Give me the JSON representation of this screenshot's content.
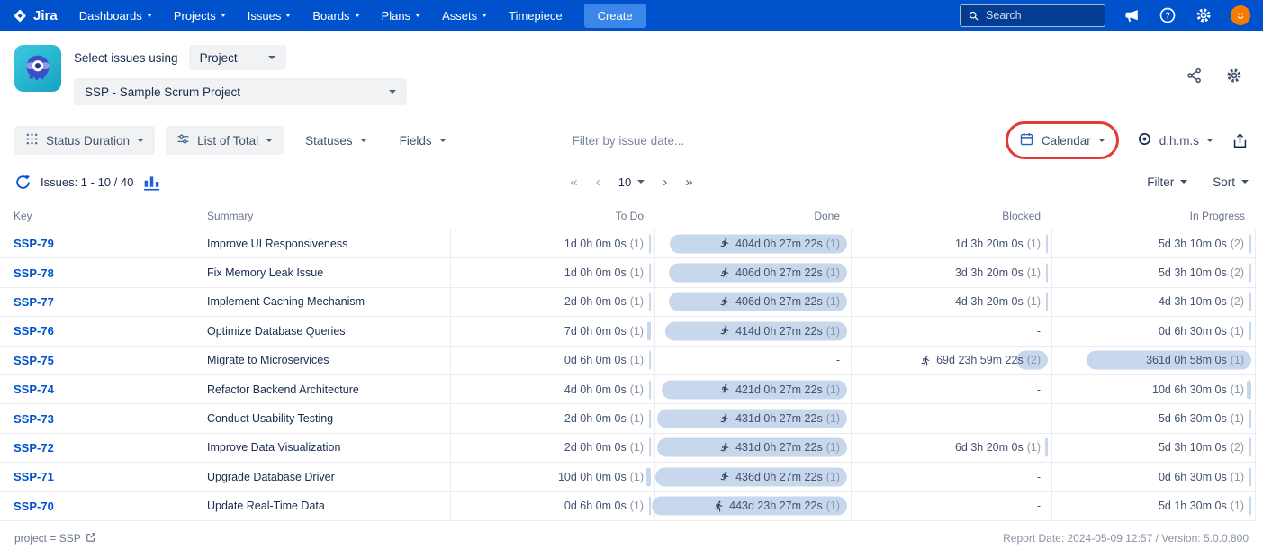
{
  "navbar": {
    "brand": "Jira",
    "items": [
      {
        "label": "Dashboards",
        "dropdown": true
      },
      {
        "label": "Projects",
        "dropdown": true
      },
      {
        "label": "Issues",
        "dropdown": true
      },
      {
        "label": "Boards",
        "dropdown": true
      },
      {
        "label": "Plans",
        "dropdown": true
      },
      {
        "label": "Assets",
        "dropdown": true
      },
      {
        "label": "Timepiece",
        "dropdown": false
      }
    ],
    "create_label": "Create",
    "search_placeholder": "Search"
  },
  "header": {
    "select_issues_label": "Select issues using",
    "issue_source": "Project",
    "project": "SSP - Sample Scrum Project"
  },
  "toolbar": {
    "report_type": "Status Duration",
    "list_mode": "List of Total",
    "statuses_label": "Statuses",
    "fields_label": "Fields",
    "date_filter_placeholder": "Filter by issue date...",
    "calendar_label": "Calendar",
    "time_format": "d.h.m.s"
  },
  "resultsbar": {
    "issues_label": "Issues: 1 - 10 / 40",
    "pagination": {
      "first": "«",
      "prev": "‹",
      "page_size": "10",
      "next": "›",
      "last": "»"
    },
    "filter_label": "Filter",
    "sort_label": "Sort"
  },
  "table": {
    "columns": [
      "Key",
      "Summary",
      "To Do",
      "Done",
      "Blocked",
      "In Progress"
    ],
    "max_days": 444,
    "rows": [
      {
        "key": "SSP-79",
        "summary": "Improve UI Responsiveness",
        "todo": {
          "text": "1d 0h 0m 0s",
          "count": "(1)",
          "days": 1
        },
        "done": {
          "text": "404d 0h 27m 22s",
          "count": "(1)",
          "days": 404,
          "runner": true
        },
        "blocked": {
          "text": "1d 3h 20m 0s",
          "count": "(1)",
          "days": 1.14
        },
        "inprogress": {
          "text": "5d 3h 10m 0s",
          "count": "(2)",
          "days": 5.13
        }
      },
      {
        "key": "SSP-78",
        "summary": "Fix Memory Leak Issue",
        "todo": {
          "text": "1d 0h 0m 0s",
          "count": "(1)",
          "days": 1
        },
        "done": {
          "text": "406d 0h 27m 22s",
          "count": "(1)",
          "days": 406,
          "runner": true
        },
        "blocked": {
          "text": "3d 3h 20m 0s",
          "count": "(1)",
          "days": 3.14
        },
        "inprogress": {
          "text": "5d 3h 10m 0s",
          "count": "(2)",
          "days": 5.13
        }
      },
      {
        "key": "SSP-77",
        "summary": "Implement Caching Mechanism",
        "todo": {
          "text": "2d 0h 0m 0s",
          "count": "(1)",
          "days": 2
        },
        "done": {
          "text": "406d 0h 27m 22s",
          "count": "(1)",
          "days": 406,
          "runner": true
        },
        "blocked": {
          "text": "4d 3h 20m 0s",
          "count": "(1)",
          "days": 4.14
        },
        "inprogress": {
          "text": "4d 3h 10m 0s",
          "count": "(2)",
          "days": 4.13
        }
      },
      {
        "key": "SSP-76",
        "summary": "Optimize Database Queries",
        "todo": {
          "text": "7d 0h 0m 0s",
          "count": "(1)",
          "days": 7
        },
        "done": {
          "text": "414d 0h 27m 22s",
          "count": "(1)",
          "days": 414,
          "runner": true
        },
        "blocked": null,
        "inprogress": {
          "text": "0d 6h 30m 0s",
          "count": "(1)",
          "days": 0.27
        }
      },
      {
        "key": "SSP-75",
        "summary": "Migrate to Microservices",
        "todo": {
          "text": "0d 6h 0m 0s",
          "count": "(1)",
          "days": 0.25
        },
        "done": null,
        "blocked": {
          "text": "69d 23h 59m 22s",
          "count": "(2)",
          "days": 70,
          "runner": true
        },
        "inprogress": {
          "text": "361d 0h 58m 0s",
          "count": "(1)",
          "days": 361
        }
      },
      {
        "key": "SSP-74",
        "summary": "Refactor Backend Architecture",
        "todo": {
          "text": "4d 0h 0m 0s",
          "count": "(1)",
          "days": 4
        },
        "done": {
          "text": "421d 0h 27m 22s",
          "count": "(1)",
          "days": 421,
          "runner": true
        },
        "blocked": null,
        "inprogress": {
          "text": "10d 6h 30m 0s",
          "count": "(1)",
          "days": 10.27
        }
      },
      {
        "key": "SSP-73",
        "summary": "Conduct Usability Testing",
        "todo": {
          "text": "2d 0h 0m 0s",
          "count": "(1)",
          "days": 2
        },
        "done": {
          "text": "431d 0h 27m 22s",
          "count": "(1)",
          "days": 431,
          "runner": true
        },
        "blocked": null,
        "inprogress": {
          "text": "5d 6h 30m 0s",
          "count": "(1)",
          "days": 5.27
        }
      },
      {
        "key": "SSP-72",
        "summary": "Improve Data Visualization",
        "todo": {
          "text": "2d 0h 0m 0s",
          "count": "(1)",
          "days": 2
        },
        "done": {
          "text": "431d 0h 27m 22s",
          "count": "(1)",
          "days": 431,
          "runner": true
        },
        "blocked": {
          "text": "6d 3h 20m 0s",
          "count": "(1)",
          "days": 6.14
        },
        "inprogress": {
          "text": "5d 3h 10m 0s",
          "count": "(2)",
          "days": 5.13
        }
      },
      {
        "key": "SSP-71",
        "summary": "Upgrade Database Driver",
        "todo": {
          "text": "10d 0h 0m 0s",
          "count": "(1)",
          "days": 10
        },
        "done": {
          "text": "436d 0h 27m 22s",
          "count": "(1)",
          "days": 436,
          "runner": true
        },
        "blocked": null,
        "inprogress": {
          "text": "0d 6h 30m 0s",
          "count": "(1)",
          "days": 0.27
        }
      },
      {
        "key": "SSP-70",
        "summary": "Update Real-Time Data",
        "todo": {
          "text": "0d 6h 0m 0s",
          "count": "(1)",
          "days": 0.25
        },
        "done": {
          "text": "443d 23h 27m 22s",
          "count": "(1)",
          "days": 443.98,
          "runner": true
        },
        "blocked": null,
        "inprogress": {
          "text": "5d 1h 30m 0s",
          "count": "(1)",
          "days": 5.06
        }
      }
    ]
  },
  "footer": {
    "filter_text": "project = SSP",
    "report_info": "Report Date: 2024-05-09 12:57 / Version: 5.0.0.800"
  },
  "colors": {
    "navbar": "#0052CC",
    "create_button": "#3A86E9",
    "link": "#0052CC",
    "duration_bar": "#C7D8EC",
    "annotation": "#E23B36",
    "row_border": "#EBECF0"
  }
}
